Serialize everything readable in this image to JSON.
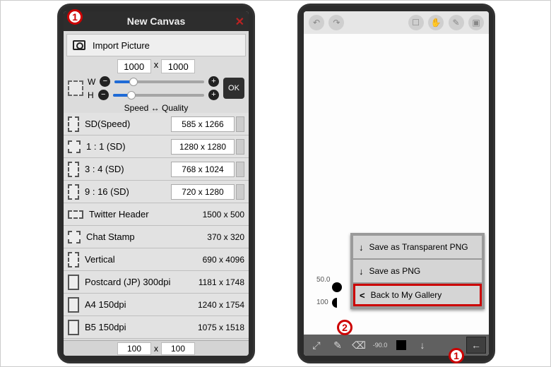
{
  "left": {
    "title": "New Canvas",
    "importLabel": "Import Picture",
    "topW": "1000",
    "topH": "1000",
    "wLabel": "W",
    "hLabel": "H",
    "okLabel": "OK",
    "speedQuality": "Speed ↔ Quality",
    "presets": [
      {
        "name": "SD(Speed)",
        "dims": "585 x 1266",
        "editable": true,
        "sw": "h24"
      },
      {
        "name": "1 : 1 (SD)",
        "dims": "1280 x 1280",
        "editable": true,
        "sw": "sq"
      },
      {
        "name": "3 : 4 (SD)",
        "dims": "768 x 1024",
        "editable": true,
        "sw": "h24"
      },
      {
        "name": "9 : 16 (SD)",
        "dims": "720 x 1280",
        "editable": true,
        "sw": "h24"
      },
      {
        "name": "Twitter Header",
        "dims": "1500 x 500",
        "editable": false,
        "sw": "wide"
      },
      {
        "name": "Chat Stamp",
        "dims": "370 x 320",
        "editable": false,
        "sw": "sq"
      },
      {
        "name": "Vertical",
        "dims": "690 x 4096",
        "editable": false,
        "sw": "h24"
      },
      {
        "name": "Postcard (JP) 300dpi",
        "dims": "1181 x 1748",
        "editable": false,
        "sw": "h24",
        "solid": true
      },
      {
        "name": "A4 150dpi",
        "dims": "1240 x 1754",
        "editable": false,
        "sw": "h24",
        "solid": true
      },
      {
        "name": "B5 150dpi",
        "dims": "1075 x 1518",
        "editable": false,
        "sw": "h24",
        "solid": true
      }
    ],
    "footerW": "100",
    "footerH": "100"
  },
  "right": {
    "brushSize": "50.0",
    "brushOp": "100",
    "menu": [
      {
        "label": "Save as Transparent PNG",
        "icon": "download"
      },
      {
        "label": "Save as PNG",
        "icon": "download"
      },
      {
        "label": "Back to My Gallery",
        "icon": "back",
        "highlight": true
      }
    ],
    "barLabel": "-90.0"
  },
  "callouts": {
    "one": "1",
    "two": "2",
    "one_b": "1"
  }
}
